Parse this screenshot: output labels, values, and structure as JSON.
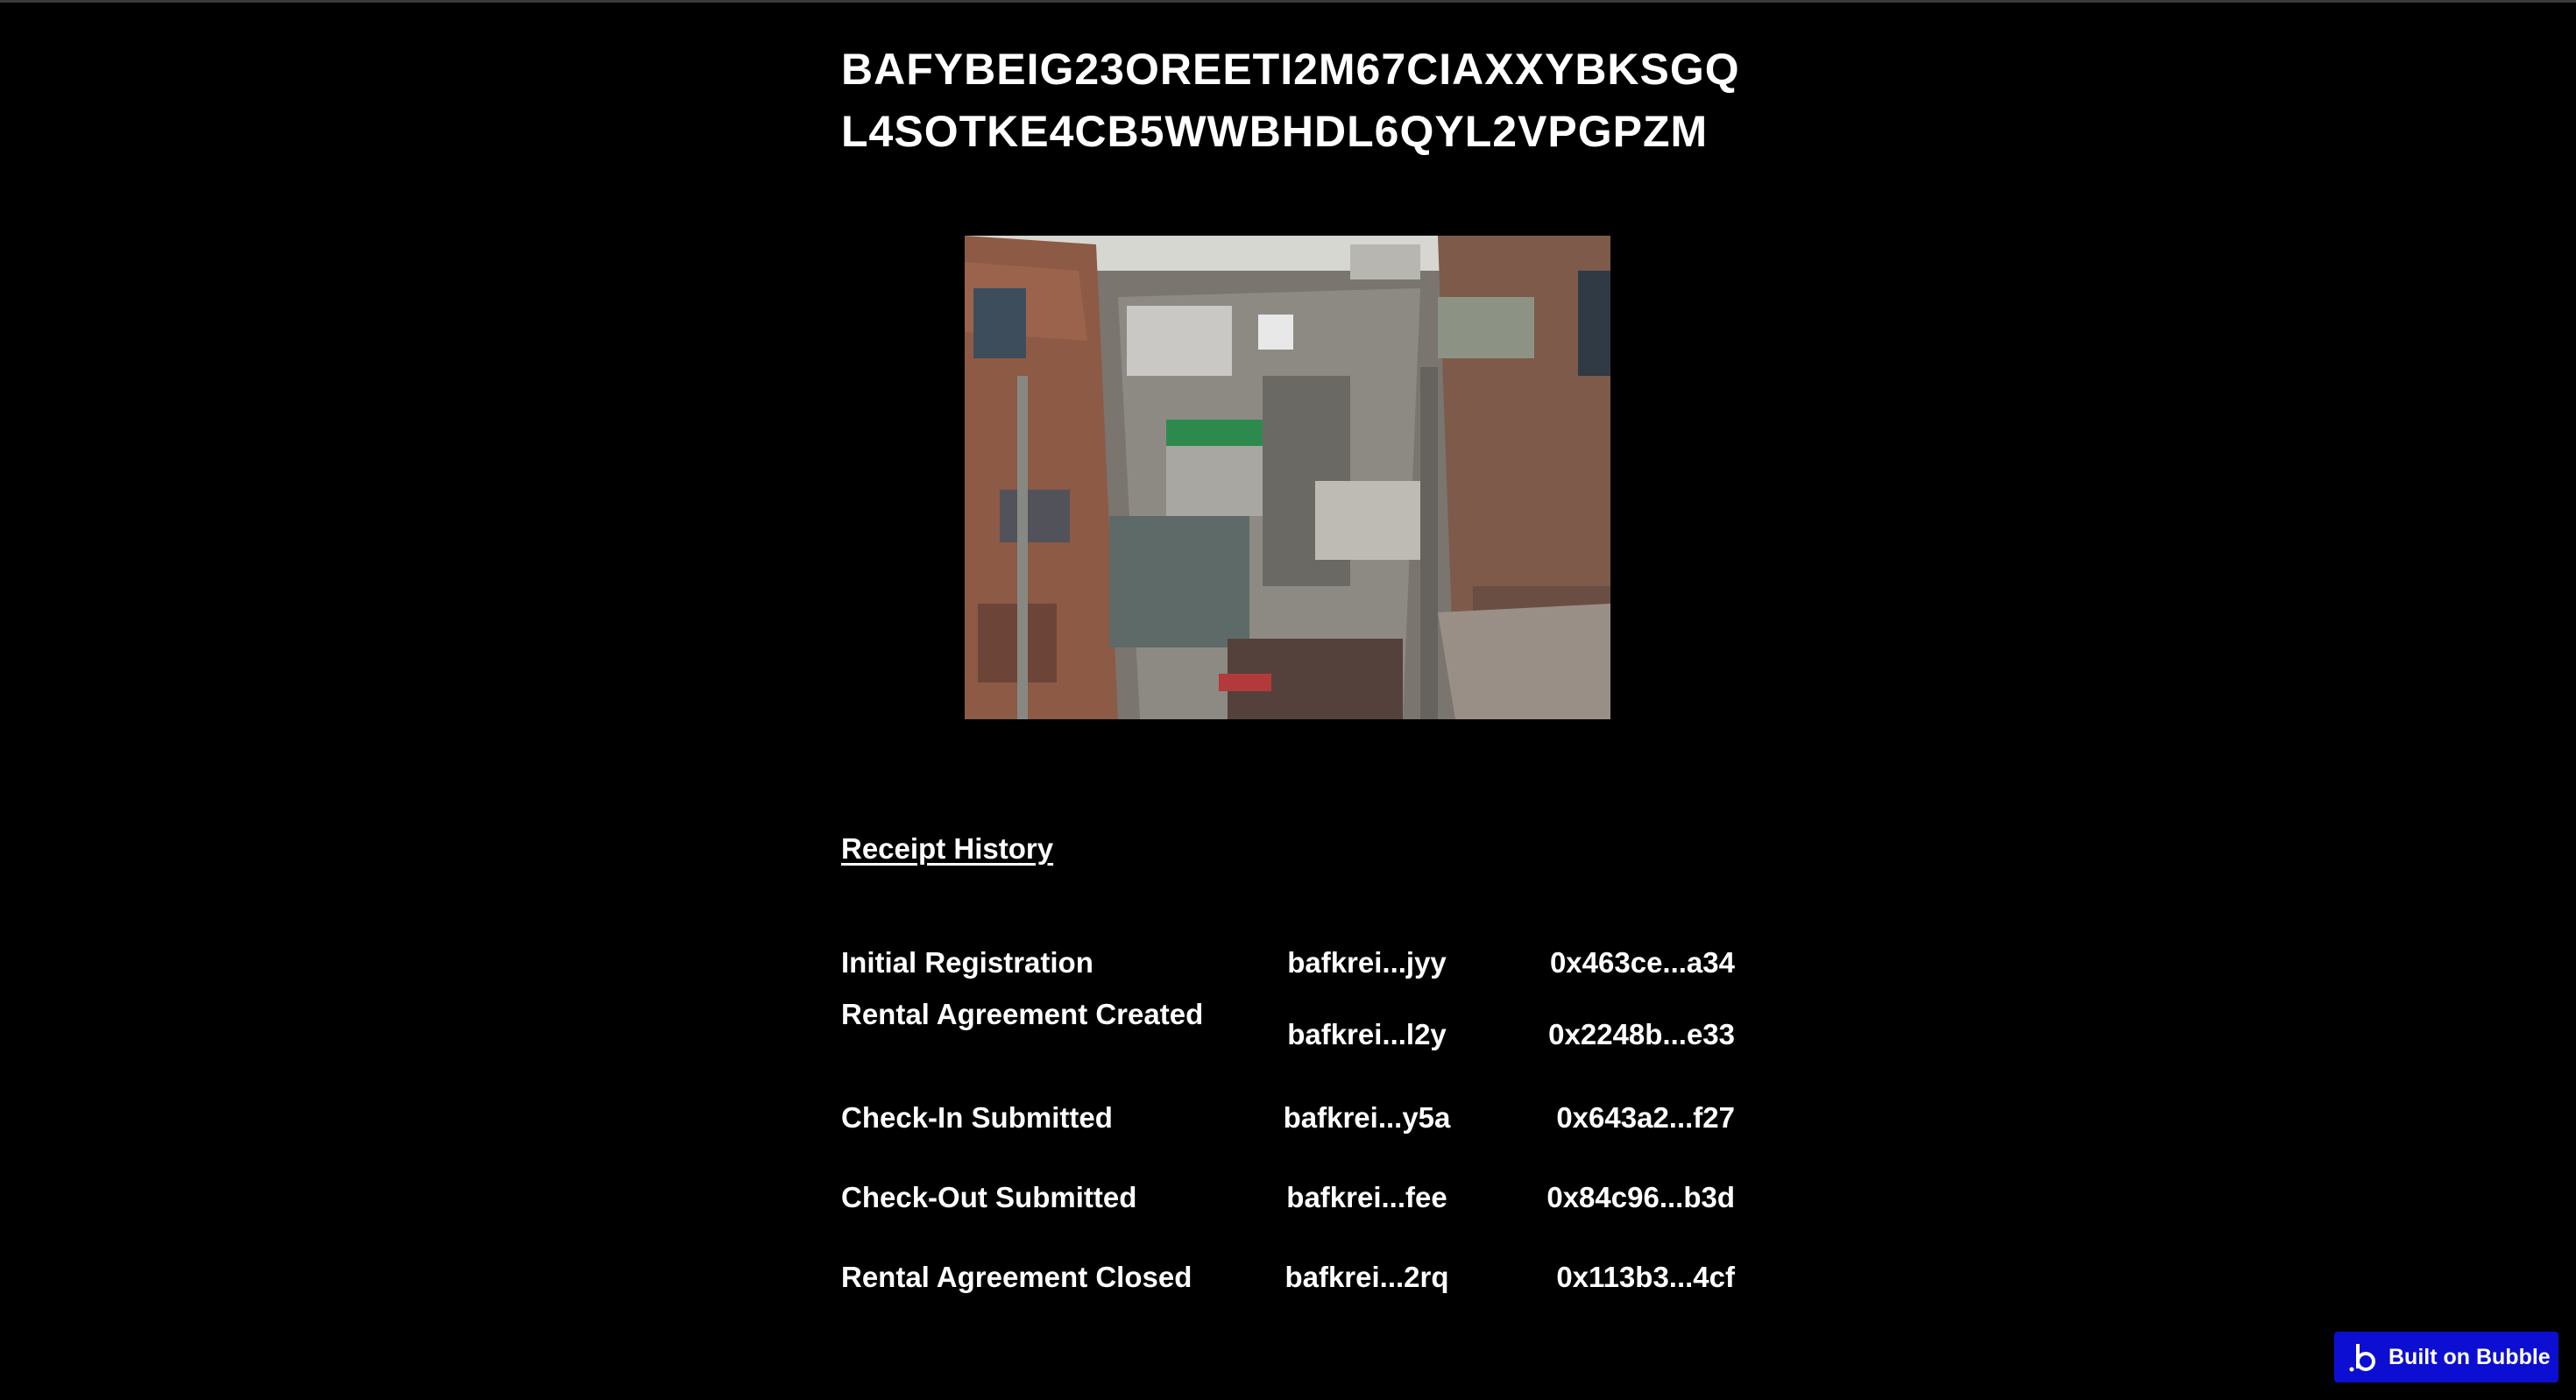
{
  "asset": {
    "cid_line_1": "BAFYBEIG23OREETI2M67CIAXXYBKSGQ",
    "cid_line_2": "L4SOTKE4CB5WWBHDL6QYL2VPGPZM"
  },
  "receipt_history": {
    "heading": "Receipt History",
    "rows": [
      {
        "event": "Initial Registration",
        "cid": "bafkrei...jyy",
        "tx": "0x463ce...a34"
      },
      {
        "event": "Rental Agreement Created",
        "cid": "bafkrei...l2y",
        "tx": "0x2248b...e33"
      },
      {
        "event": "Check-In Submitted",
        "cid": "bafkrei...y5a",
        "tx": "0x643a2...f27"
      },
      {
        "event": "Check-Out Submitted",
        "cid": "bafkrei...fee",
        "tx": "0x84c96...b3d"
      },
      {
        "event": "Rental Agreement Closed",
        "cid": "bafkrei...2rq",
        "tx": "0x113b3...4cf"
      }
    ]
  },
  "badge": {
    "label": "Built on Bubble",
    "icon": "bubble-logo-icon",
    "color": "#0c0fd1"
  },
  "photo": {
    "icon": "property-photo"
  }
}
